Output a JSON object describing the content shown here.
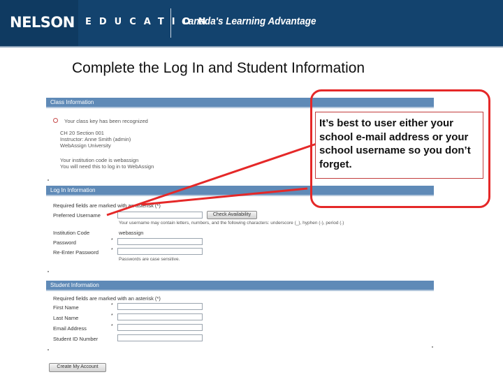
{
  "header": {
    "brand": "NELSON",
    "division": "EDUCATION",
    "tagline": "Canada's Learning Advantage"
  },
  "slide_title": "Complete the Log In and Student Information",
  "class_info": {
    "section_title": "Class Information",
    "recognized": "Your class key has been recognized",
    "lines": [
      "CH 20  Section 001",
      "Instructor: Anne Smith (admin)",
      "WebAssign University"
    ],
    "note_lines": [
      "Your institution code is webassign",
      "You will need this to log in to WebAssign"
    ]
  },
  "login_info": {
    "section_title": "Log In Information",
    "required_note": "Required fields are marked with an asterisk (*)",
    "preferred_username_label": "Preferred Username",
    "check_availability": "Check Availability",
    "username_hint": "Your username may contain letters, numbers, and the following characters: underscore (_), hyphen (-), period (.)",
    "institution_label": "Institution Code",
    "institution_value": "webassign",
    "password_label": "Password",
    "reenter_label": "Re-Enter Password",
    "case_note": "Passwords are case sensitive."
  },
  "student_info": {
    "section_title": "Student Information",
    "required_note": "Required fields are marked with an asterisk (*)",
    "first_name": "First Name",
    "last_name": "Last Name",
    "email": "Email Address",
    "student_id": "Student ID Number"
  },
  "create_button": "Create My Account",
  "callout": {
    "text": "It’s best to user either your school e-mail address or your school username so you don’t forget."
  },
  "colors": {
    "header_bg": "#13436e",
    "section_bar": "#5f8ab7",
    "callout_border": "#e52828"
  }
}
